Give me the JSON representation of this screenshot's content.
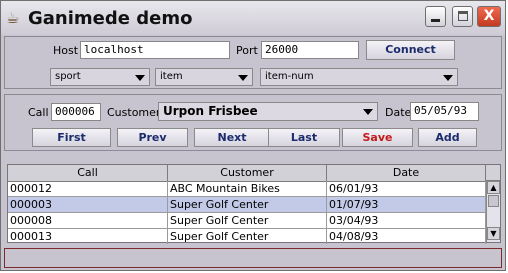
{
  "window": {
    "title": "Ganimede demo",
    "icon": "java-cup-icon",
    "controls": {
      "minimize": "minimize",
      "maximize": "maximize",
      "close": "X"
    }
  },
  "connection": {
    "host_label": "Host",
    "host_value": "localhost",
    "port_label": "Port",
    "port_value": "26000",
    "connect_label": "Connect"
  },
  "selectors": {
    "database": "sport",
    "table": "item",
    "index": "item-num"
  },
  "record": {
    "call_label": "Call",
    "call_value": "000006",
    "customer_label": "Customer",
    "customer_value": "Urpon Frisbee",
    "date_label": "Date",
    "date_value": "05/05/93"
  },
  "nav": {
    "first": "First",
    "prev": "Prev",
    "next": "Next",
    "last": "Last",
    "save": "Save",
    "add": "Add"
  },
  "table": {
    "columns": [
      "Call",
      "Customer",
      "Date"
    ],
    "rows": [
      [
        "000012",
        "ABC Mountain Bikes",
        "06/01/93"
      ],
      [
        "000003",
        "Super Golf Center",
        "01/07/93"
      ],
      [
        "000008",
        "Super Golf Center",
        "03/04/93"
      ],
      [
        "000013",
        "Super Golf Center",
        "04/08/93"
      ]
    ],
    "selected_row": 1
  },
  "colors": {
    "save_text": "#c41a1a",
    "button_text": "#1b2c6e",
    "selected_row": "#c2cae8",
    "close_button": "#d9462b"
  }
}
